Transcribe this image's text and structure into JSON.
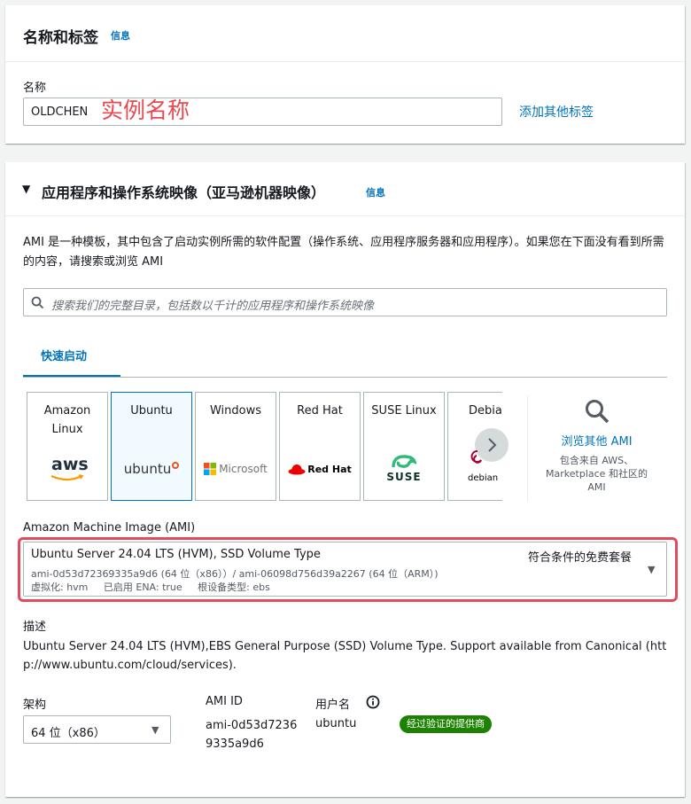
{
  "name_section": {
    "title": "名称和标签",
    "info": "信息",
    "name_label": "名称",
    "name_value": "OLDCHEN",
    "annotation": "实例名称",
    "add_tags_link": "添加其他标签"
  },
  "ami_section": {
    "title": "应用程序和操作系统映像（亚马逊机器映像）",
    "info": "信息",
    "description": "AMI 是一种模板，其中包含了启动实例所需的软件配置（操作系统、应用程序服务器和应用程序）。如果您在下面没有看到所需的内容，请搜索或浏览 AMI",
    "search_placeholder": "搜索我们的完整目录，包括数以千计的应用程序和操作系统映像",
    "tab_quickstart": "快速启动",
    "tiles": [
      {
        "name": "Amazon Linux",
        "logo": "aws"
      },
      {
        "name": "Ubuntu",
        "logo": "ubuntu"
      },
      {
        "name": "Windows",
        "logo": "Microsoft"
      },
      {
        "name": "Red Hat",
        "logo": "Red Hat"
      },
      {
        "name": "SUSE Linux",
        "logo": "SUSE"
      },
      {
        "name": "Debia",
        "logo": "debian"
      }
    ],
    "browse_more": "浏览其他 AMI",
    "browse_sub": "包含来自 AWS、Marketplace 和社区的 AMI",
    "ami_label": "Amazon Machine Image (AMI)",
    "ami_selected": {
      "name": "Ubuntu Server 24.04 LTS (HVM), SSD Volume Type",
      "free_tier": "符合条件的免费套餐",
      "ids": "ami-0d53d72369335a9d6 (64 位（x86））/ ami-06098d756d39a2267 (64 位（ARM）)",
      "meta": "虚拟化: hvm     已启用 ENA: true     根设备类型: ebs"
    },
    "desc_label": "描述",
    "desc_text": "Ubuntu Server 24.04 LTS (HVM),EBS General Purpose (SSD) Volume Type. Support available from Canonical (http://www.ubuntu.com/cloud/services).",
    "arch_label": "架构",
    "arch_value": "64 位（x86）",
    "amiid_label": "AMI ID",
    "amiid_value_1": "ami-0d53d7236",
    "amiid_value_2": "9335a9d6",
    "username_label": "用户名",
    "username_value": "ubuntu",
    "verified_badge": "经过验证的提供商"
  },
  "colors": {
    "link": "#0073bb",
    "annotation": "#e8484f",
    "highlight_border": "#e34a5b",
    "badge": "#1d8102"
  }
}
